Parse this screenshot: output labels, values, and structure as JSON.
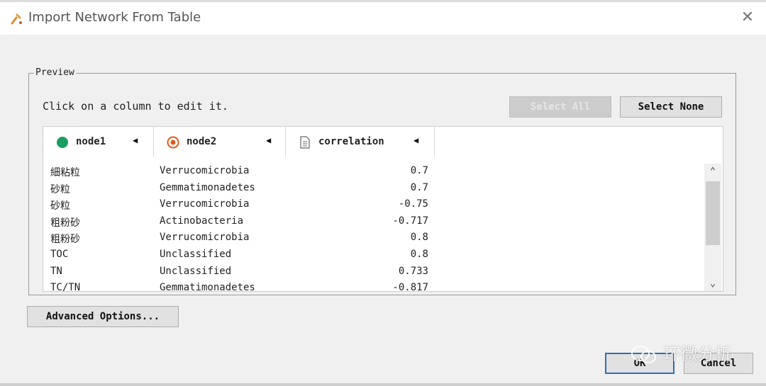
{
  "window": {
    "title": "Import Network From Table",
    "close_glyph": "✕"
  },
  "preview": {
    "legend": "Preview",
    "instruction": "Click on a column to edit it.",
    "select_all_label": "Select All",
    "select_none_label": "Select None"
  },
  "table": {
    "columns": [
      {
        "label": "node1",
        "icon": "source-node-icon",
        "color": "#1a9e60"
      },
      {
        "label": "node2",
        "icon": "target-node-icon",
        "color": "#e05a1e"
      },
      {
        "label": "correlation",
        "icon": "edge-attribute-document-icon"
      }
    ],
    "rows": [
      {
        "node1": "細粘粒",
        "node2": "Verrucomicrobia",
        "correlation": "0.7"
      },
      {
        "node1": "砂粒",
        "node2": "Gemmatimonadetes",
        "correlation": "0.7"
      },
      {
        "node1": "砂粒",
        "node2": "Verrucomicrobia",
        "correlation": "-0.75"
      },
      {
        "node1": "粗粉砂",
        "node2": "Actinobacteria",
        "correlation": "-0.717"
      },
      {
        "node1": "粗粉砂",
        "node2": "Verrucomicrobia",
        "correlation": "0.8"
      },
      {
        "node1": "TOC",
        "node2": "Unclassified",
        "correlation": "0.8"
      },
      {
        "node1": "TN",
        "node2": "Unclassified",
        "correlation": "0.733"
      },
      {
        "node1": "TC/TN",
        "node2": "Gemmatimonadetes",
        "correlation": "-0.817"
      }
    ]
  },
  "footer": {
    "advanced_label": "Advanced Options...",
    "ok_label": "OK",
    "cancel_label": "Cancel"
  },
  "watermark": {
    "text": "环微分析"
  }
}
